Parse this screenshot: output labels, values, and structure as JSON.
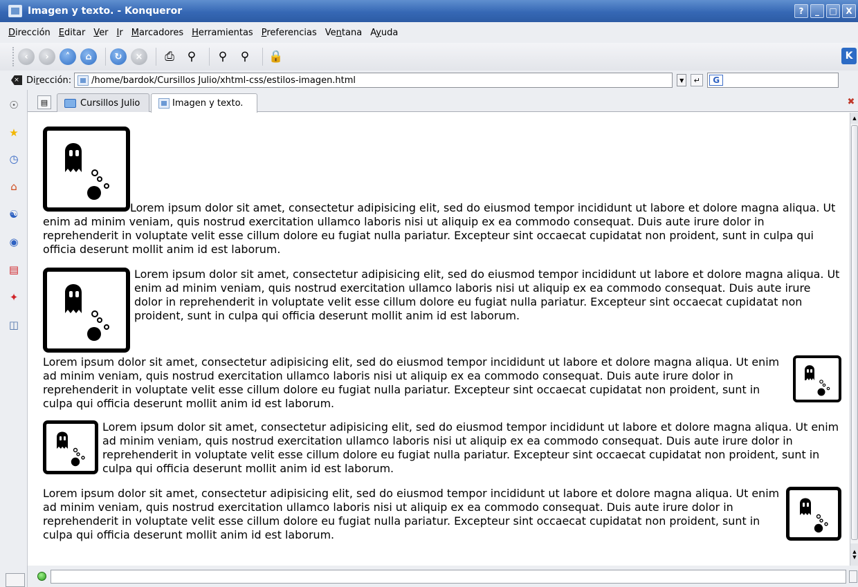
{
  "window": {
    "title": "Imagen y texto. - Konqueror",
    "buttons": {
      "help": "?",
      "minimize": "_",
      "maximize": "□",
      "close": "X"
    }
  },
  "menu": {
    "items": [
      {
        "pre": "",
        "u": "D",
        "post": "irección"
      },
      {
        "pre": "",
        "u": "E",
        "post": "ditar"
      },
      {
        "pre": "",
        "u": "V",
        "post": "er"
      },
      {
        "pre": "",
        "u": "I",
        "post": "r"
      },
      {
        "pre": "",
        "u": "M",
        "post": "arcadores"
      },
      {
        "pre": "",
        "u": "H",
        "post": "erramientas"
      },
      {
        "pre": "",
        "u": "P",
        "post": "referencias"
      },
      {
        "pre": "Ve",
        "u": "n",
        "post": "tana"
      },
      {
        "pre": "A",
        "u": "y",
        "post": "uda"
      }
    ]
  },
  "toolbar": {
    "icons": [
      "back-icon",
      "forward-icon",
      "up-icon",
      "home-icon",
      "reload-icon",
      "stop-icon",
      "print-icon",
      "find-icon",
      "zoom-in-icon",
      "zoom-out-icon",
      "lock-icon"
    ],
    "kde_logo": "K"
  },
  "location": {
    "label_pre": "Di",
    "label_u": "r",
    "label_post": "ección:",
    "url": "/home/bardok/Cursillos Julio/xhtml-css/estilos-imagen.html",
    "search_engine_letter": "G"
  },
  "tabs": [
    {
      "label": "Cursillos Julio",
      "active": false
    },
    {
      "label": "Imagen y texto.",
      "active": true
    }
  ],
  "content": {
    "paragraphs": [
      {
        "text": "Lorem ipsum dolor sit amet, consectetur adipisicing elit, sed do eiusmod tempor incididunt ut labore et dolore magna aliqua. Ut enim ad minim veniam, quis nostrud exercitation ullamco laboris nisi ut aliquip ex ea commodo consequat. Duis aute irure dolor in reprehenderit in voluptate velit esse cillum dolore eu fugiat nulla pariatur. Excepteur sint occaecat cupidatat non proident, sunt in culpa qui officia deserunt mollit anim id est laborum."
      },
      {
        "text": "Lorem ipsum dolor sit amet, consectetur adipisicing elit, sed do eiusmod tempor incididunt ut labore et dolore magna aliqua. Ut enim ad minim veniam, quis nostrud exercitation ullamco laboris nisi ut aliquip ex ea commodo consequat. Duis aute irure dolor in reprehenderit in voluptate velit esse cillum dolore eu fugiat nulla pariatur. Excepteur sint occaecat cupidatat non proident, sunt in culpa qui officia deserunt mollit anim id est laborum."
      },
      {
        "text": "Lorem ipsum dolor sit amet, consectetur adipisicing elit, sed do eiusmod tempor incididunt ut labore et dolore magna aliqua. Ut enim ad minim veniam, quis nostrud exercitation ullamco laboris nisi ut aliquip ex ea commodo consequat. Duis aute irure dolor in reprehenderit in voluptate velit esse cillum dolore eu fugiat nulla pariatur. Excepteur sint occaecat cupidatat non proident, sunt in culpa qui officia deserunt mollit anim id est laborum."
      },
      {
        "text": "Lorem ipsum dolor sit amet, consectetur adipisicing elit, sed do eiusmod tempor incididunt ut labore et dolore magna aliqua. Ut enim ad minim veniam, quis nostrud exercitation ullamco laboris nisi ut aliquip ex ea commodo consequat. Duis aute irure dolor in reprehenderit in voluptate velit esse cillum dolore eu fugiat nulla pariatur. Excepteur sint occaecat cupidatat non proident, sunt in culpa qui officia deserunt mollit anim id est laborum."
      },
      {
        "text": "Lorem ipsum dolor sit amet, consectetur adipisicing elit, sed do eiusmod tempor incididunt ut labore et dolore magna aliqua. Ut enim ad minim veniam, quis nostrud exercitation ullamco laboris nisi ut aliquip ex ea commodo consequat. Duis aute irure dolor in reprehenderit in voluptate velit esse cillum dolore eu fugiat nulla pariatur. Excepteur sint occaecat cupidatat non proident, sunt in culpa qui officia deserunt mollit anim id est laborum."
      }
    ],
    "image_icon": "ghost-icon"
  },
  "sidebar": {
    "icons": [
      "konqueror-icon",
      "bookmarks-star-icon",
      "history-clock-icon",
      "home-folder-icon",
      "services-icon",
      "network-icon",
      "root-folder-icon",
      "fsview-icon",
      "media-icon"
    ]
  },
  "colors": {
    "titlebar": "#3668b5",
    "accent": "#2c6bc5",
    "chrome": "#eceef2"
  }
}
